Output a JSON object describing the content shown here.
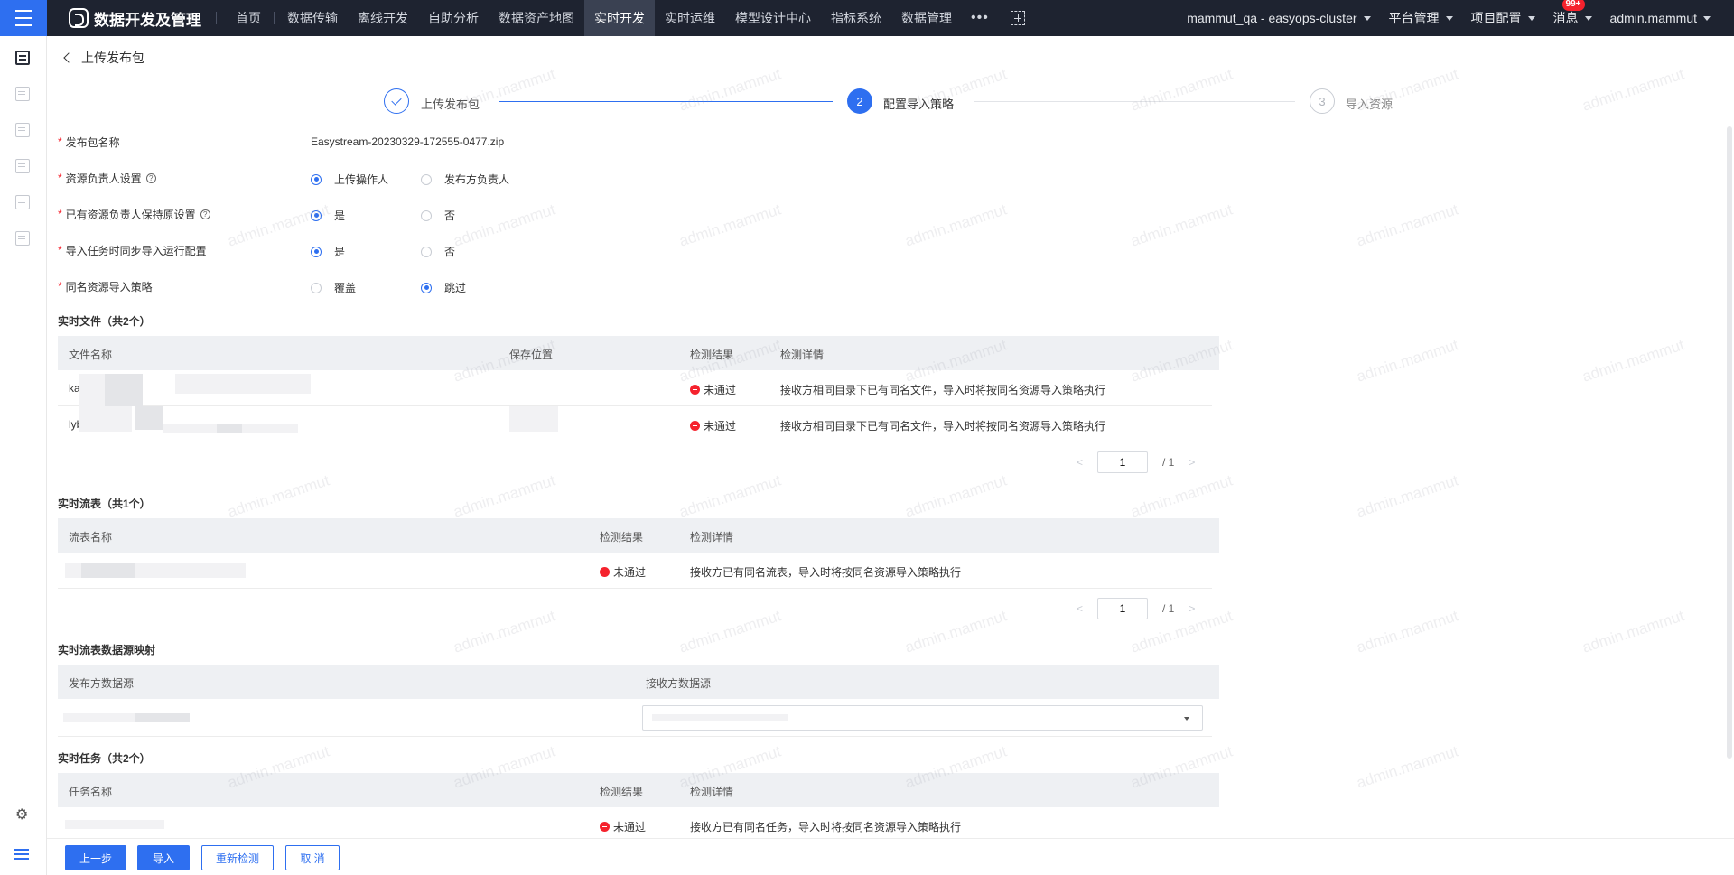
{
  "nav": {
    "logo_text": "数据开发及管理",
    "items": [
      {
        "label": "首页"
      },
      {
        "label": "数据传输"
      },
      {
        "label": "离线开发"
      },
      {
        "label": "自助分析"
      },
      {
        "label": "数据资产地图"
      },
      {
        "label": "实时开发"
      },
      {
        "label": "实时运维"
      },
      {
        "label": "模型设计中心"
      },
      {
        "label": "指标系统"
      },
      {
        "label": "数据管理"
      }
    ],
    "active": "实时开发",
    "more": "•••",
    "cluster": "mammut_qa - easyops-cluster",
    "platform": "平台管理",
    "project": "项目配置",
    "messages": "消息",
    "badge": "99+",
    "user": "admin.mammut"
  },
  "header": {
    "title": "上传发布包"
  },
  "steps": [
    {
      "label": "上传发布包",
      "status": "done"
    },
    {
      "number": "2",
      "label": "配置导入策略",
      "status": "current"
    },
    {
      "number": "3",
      "label": "导入资源",
      "status": "wait"
    }
  ],
  "form": {
    "package_name_label": "发布包名称",
    "package_name": "Easystream-20230329-172555-0477.zip",
    "owner_label": "资源负责人设置",
    "owner_opt1": "上传操作人",
    "owner_opt2": "发布方负责人",
    "keep_owner_label": "已有资源负责人保持原设置",
    "keep_owner_opt1": "是",
    "keep_owner_opt2": "否",
    "sync_config_label": "导入任务时同步导入运行配置",
    "sync_config_opt1": "是",
    "sync_config_opt2": "否",
    "same_name_label": "同名资源导入策略",
    "same_name_opt1": "覆盖",
    "same_name_opt2": "跳过",
    "help": "?"
  },
  "files_section": {
    "title": "实时文件（共2个）",
    "headers": [
      "文件名称",
      "保存位置",
      "检测结果",
      "检测详情"
    ],
    "rows": [
      {
        "name": "ka",
        "result": "未通过",
        "detail": "接收方相同目录下已有同名文件，导入时将按同名资源导入策略执行"
      },
      {
        "name": "lyb",
        "result": "未通过",
        "detail": "接收方相同目录下已有同名文件，导入时将按同名资源导入策略执行"
      }
    ],
    "page": "1",
    "total": "/   1"
  },
  "streams_section": {
    "title": "实时流表（共1个）",
    "headers": [
      "流表名称",
      "检测结果",
      "检测详情"
    ],
    "rows": [
      {
        "result": "未通过",
        "detail": "接收方已有同名流表，导入时将按同名资源导入策略执行"
      }
    ],
    "page": "1",
    "total": "/   1"
  },
  "mapping_section": {
    "title": "实时流表数据源映射",
    "headers": [
      "发布方数据源",
      "接收方数据源"
    ]
  },
  "tasks_section": {
    "title": "实时任务（共2个）",
    "headers": [
      "任务名称",
      "检测结果",
      "检测详情"
    ],
    "rows": [
      {
        "result": "未通过",
        "detail": "接收方已有同名任务，导入时将按同名资源导入策略执行"
      }
    ]
  },
  "footer": {
    "prev": "上一步",
    "import": "导入",
    "recheck": "重新检测",
    "cancel": "取 消"
  },
  "watermark": "admin.mammut",
  "colors": {
    "primary": "#2e6ff0",
    "nav_bg": "#1e2330",
    "error": "#f5222d"
  }
}
